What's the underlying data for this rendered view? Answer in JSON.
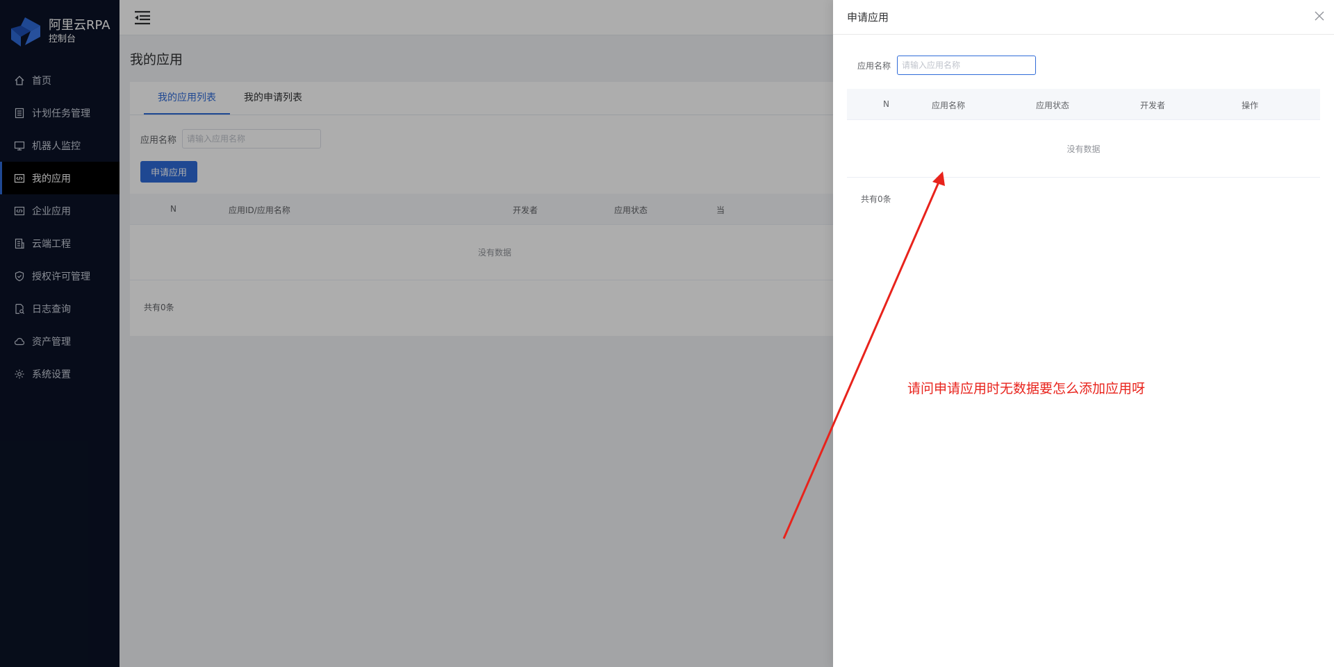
{
  "app": {
    "brand_name": "阿里云RPA",
    "brand_sub": "控制台"
  },
  "sidebar": {
    "items": [
      {
        "label": "首页",
        "icon": "home-icon",
        "active": false
      },
      {
        "label": "计划任务管理",
        "icon": "list-icon",
        "active": false
      },
      {
        "label": "机器人监控",
        "icon": "monitor-icon",
        "active": false
      },
      {
        "label": "我的应用",
        "icon": "code-window-icon",
        "active": true
      },
      {
        "label": "企业应用",
        "icon": "code-window-icon",
        "active": false
      },
      {
        "label": "云端工程",
        "icon": "building-icon",
        "active": false
      },
      {
        "label": "授权许可管理",
        "icon": "shield-check-icon",
        "active": false
      },
      {
        "label": "日志查询",
        "icon": "document-search-icon",
        "active": false
      },
      {
        "label": "资产管理",
        "icon": "cloud-icon",
        "active": false
      },
      {
        "label": "系统设置",
        "icon": "gear-icon",
        "active": false
      }
    ]
  },
  "main": {
    "page_title": "我的应用",
    "tabs": [
      {
        "label": "我的应用列表",
        "active": true
      },
      {
        "label": "我的申请列表",
        "active": false
      }
    ],
    "filter": {
      "label": "应用名称",
      "placeholder": "请输入应用名称"
    },
    "apply_button": "申请应用",
    "table": {
      "columns": [
        "N",
        "应用ID/应用名称",
        "开发者",
        "应用状态",
        "当"
      ],
      "empty_text": "没有数据",
      "total_text": "共有0条"
    }
  },
  "drawer": {
    "title": "申请应用",
    "filter": {
      "label": "应用名称",
      "placeholder": "请输入应用名称"
    },
    "table": {
      "columns": [
        "N",
        "应用名称",
        "应用状态",
        "开发者",
        "操作"
      ],
      "empty_text": "没有数据",
      "total_text": "共有0条"
    }
  },
  "annotation": {
    "text": "请问申请应用时无数据要怎么添加应用呀",
    "color": "#e8231c"
  },
  "colors": {
    "sidebar_bg": "#0b1327",
    "accent": "#2f6bd8"
  }
}
